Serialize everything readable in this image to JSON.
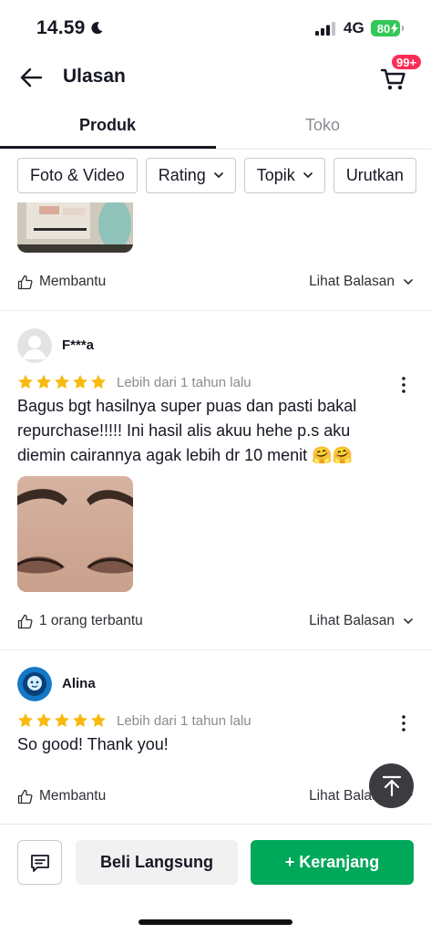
{
  "status_bar": {
    "time": "14.59",
    "network": "4G",
    "battery": "80"
  },
  "header": {
    "title": "Ulasan",
    "cart_badge": "99+"
  },
  "tabs": [
    {
      "label": "Produk",
      "active": true
    },
    {
      "label": "Toko",
      "active": false
    }
  ],
  "filters": [
    {
      "label": "Foto & Video",
      "has_dropdown": false
    },
    {
      "label": "Rating",
      "has_dropdown": true
    },
    {
      "label": "Topik",
      "has_dropdown": true
    },
    {
      "label": "Urutkan",
      "has_dropdown": false
    }
  ],
  "first_review_actions": {
    "helpful": "Membantu",
    "replies": "Lihat Balasan"
  },
  "reviews": [
    {
      "user": "F***a",
      "rating": 5,
      "date": "Lebih dari 1 tahun lalu",
      "text": "Bagus bgt hasilnya super puas dan pasti bakal repurchase!!!!! Ini hasil alis akuu hehe p.s aku diemin cairannya agak lebih dr 10 menit 🤗🤗",
      "helpful": "1 orang terbantu",
      "replies": "Lihat Balasan"
    },
    {
      "user": "Alina",
      "rating": 5,
      "date": "Lebih dari 1 tahun lalu",
      "text": "So good! Thank you!",
      "helpful": "Membantu",
      "replies": "Lihat Balasan"
    }
  ],
  "bottom_bar": {
    "buy_now": "Beli Langsung",
    "add_to_cart": "+ Keranjang"
  },
  "colors": {
    "accent_green": "#00a85a",
    "badge_red": "#fe2c55",
    "star_yellow": "#f9b90f",
    "battery_green": "#34c759"
  },
  "icons": [
    "moon-icon",
    "signal-icon",
    "back-arrow-icon",
    "cart-icon",
    "chevron-down-icon",
    "thumbs-up-icon",
    "star-icon",
    "more-vertical-icon",
    "arrow-up-icon",
    "chat-icon"
  ]
}
